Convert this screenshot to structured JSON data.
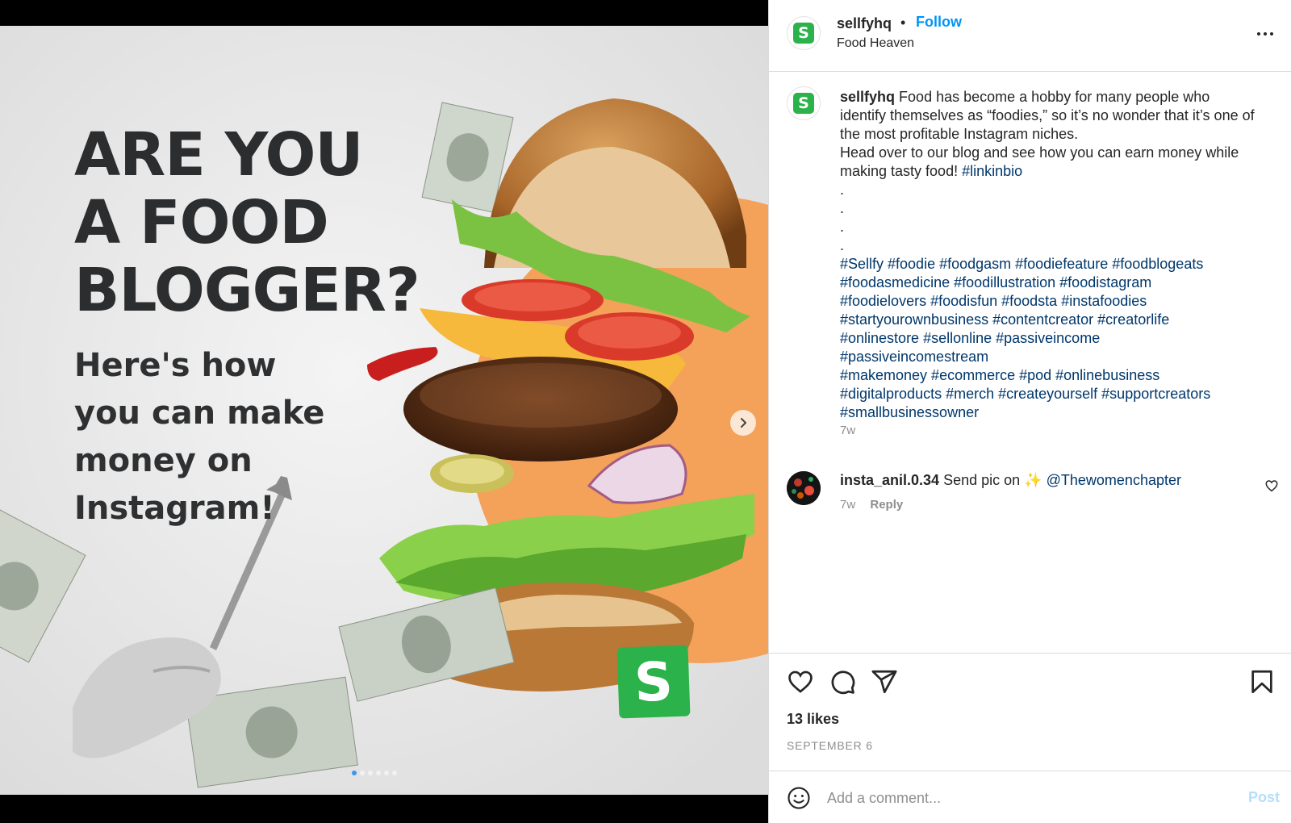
{
  "post_image": {
    "headline_lines": [
      "ARE YOU",
      "A FOOD",
      "BLOGGER?"
    ],
    "subhead_lines": [
      "Here's how",
      "you can make",
      "money on",
      "Instagram!"
    ],
    "brand_mark": "S",
    "carousel": {
      "slide_count": 6,
      "active_index": 0,
      "next_icon": "chevron-right-icon"
    }
  },
  "header": {
    "avatar_letter": "S",
    "username": "sellfyhq",
    "separator": "•",
    "follow_label": "Follow",
    "location": "Food Heaven",
    "more_icon": "more-horizontal-icon"
  },
  "caption": {
    "avatar_letter": "S",
    "username": "sellfyhq",
    "text_1": "Food has become a hobby for many people who identify themselves as “foodies,” so it’s no wonder that it’s one of the most profitable Instagram niches.",
    "text_2": "Head over to our blog and see how you can earn money while making tasty food!",
    "link_tag": "#linkinbio",
    "dots": [
      ".",
      ".",
      ".",
      "."
    ],
    "hashtag_lines": [
      "#Sellfy #foodie #foodgasm #foodiefeature #foodblogeats",
      "#foodasmedicine #foodillustration #foodistagram",
      "#foodielovers #foodisfun #foodsta #instafoodies",
      "#startyourownbusiness #contentcreator #creatorlife",
      "#onlinestore #sellonline #passiveincome",
      "#passiveincomestream",
      "#makemoney #ecommerce #pod #onlinebusiness",
      "#digitalproducts #merch #createyourself #supportcreators",
      "#smallbusinessowner"
    ],
    "time": "7w"
  },
  "comment": {
    "username": "insta_anil.0.34",
    "text": "Send pic on",
    "emoji": "✨",
    "mention": "@Thewomenchapter",
    "time": "7w",
    "reply_label": "Reply",
    "like_icon": "heart-outline-icon"
  },
  "actions": {
    "icons": [
      "heart-icon",
      "comment-icon",
      "share-icon",
      "bookmark-icon"
    ],
    "likes": "13 likes",
    "date": "SEPTEMBER 6"
  },
  "add_comment": {
    "emoji_icon": "smiley-icon",
    "placeholder": "Add a comment...",
    "post_label": "Post"
  },
  "colors": {
    "accent": "#0095f6",
    "hashtag": "#00376b",
    "brand_green": "#2cb24a",
    "post_disabled": "#b2dffc",
    "orange_circle": "#f4a15a"
  }
}
